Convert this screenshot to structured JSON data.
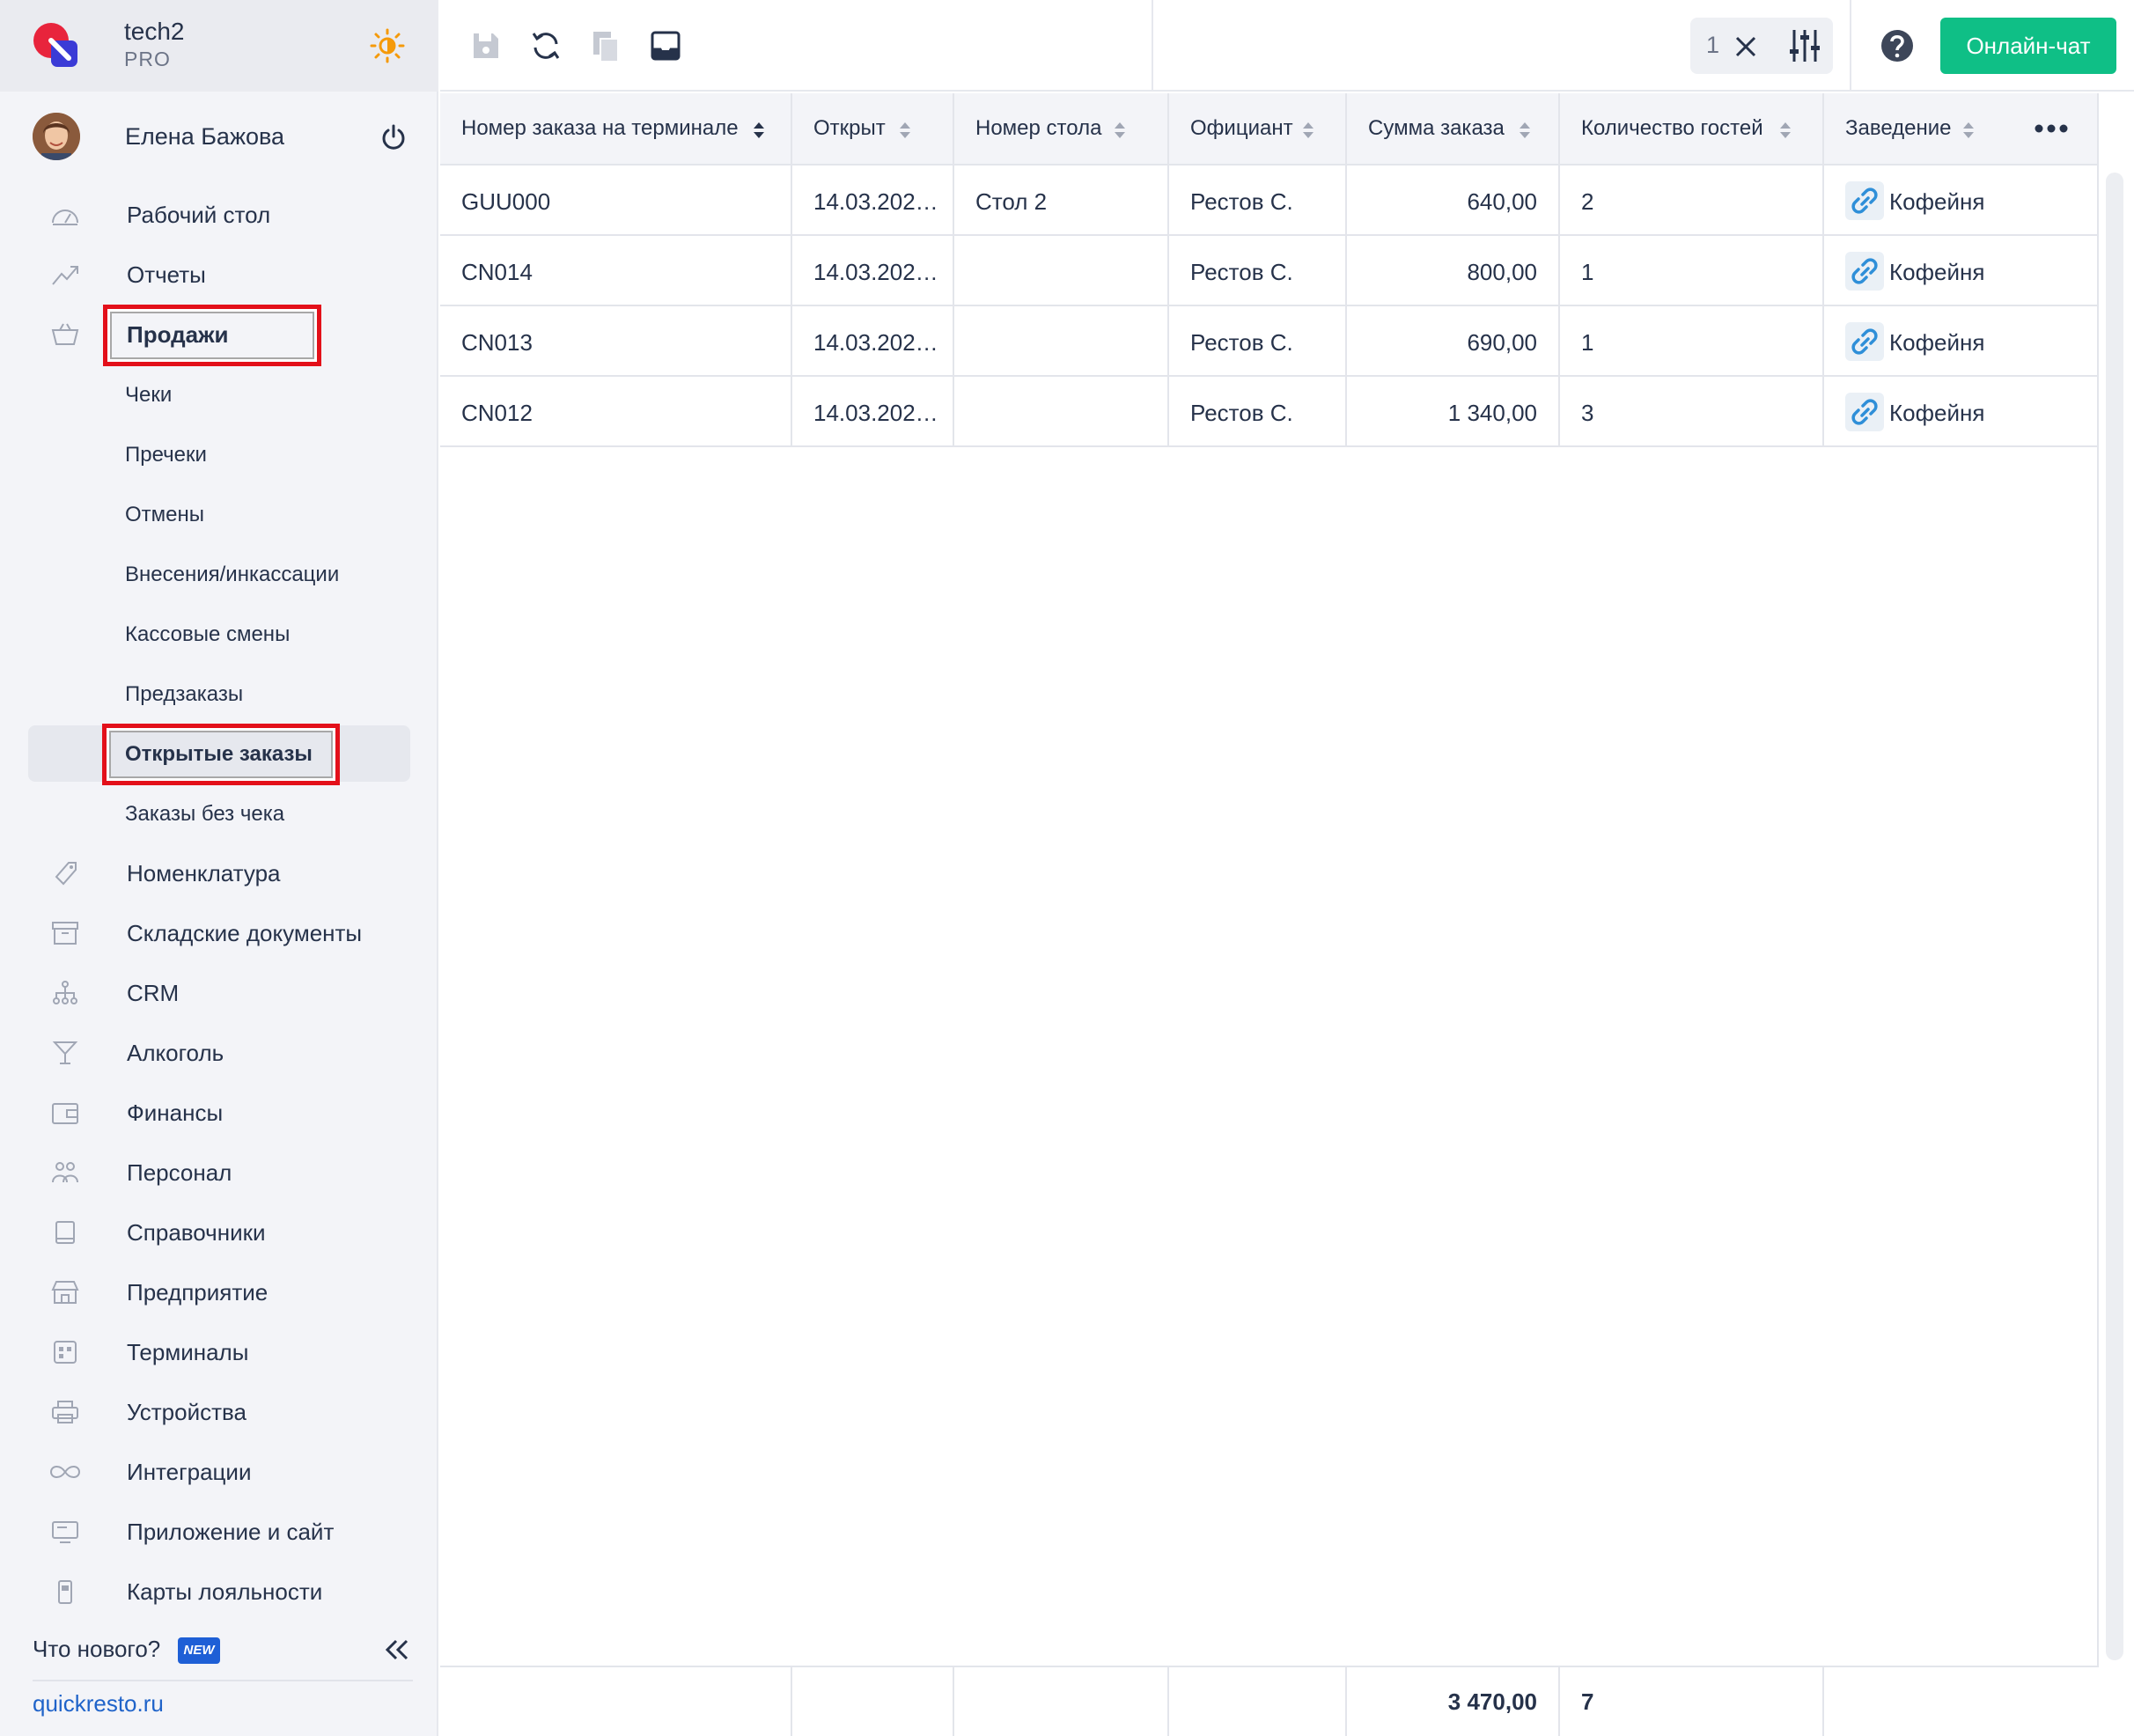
{
  "brand": {
    "name": "tech2",
    "plan": "PRO"
  },
  "user": {
    "name": "Елена Бажова"
  },
  "sidebar": {
    "items": [
      {
        "label": "Рабочий стол",
        "icon": "dashboard-icon"
      },
      {
        "label": "Отчеты",
        "icon": "chart-up-icon"
      },
      {
        "label": "Продажи",
        "icon": "basket-icon"
      },
      {
        "label": "Номенклатура",
        "icon": "tag-icon"
      },
      {
        "label": "Складские документы",
        "icon": "archive-icon"
      },
      {
        "label": "CRM",
        "icon": "hierarchy-icon"
      },
      {
        "label": "Алкоголь",
        "icon": "cocktail-icon"
      },
      {
        "label": "Финансы",
        "icon": "wallet-icon"
      },
      {
        "label": "Персонал",
        "icon": "people-icon"
      },
      {
        "label": "Справочники",
        "icon": "book-icon"
      },
      {
        "label": "Предприятие",
        "icon": "store-icon"
      },
      {
        "label": "Терминалы",
        "icon": "qr-icon"
      },
      {
        "label": "Устройства",
        "icon": "printer-icon"
      },
      {
        "label": "Интеграции",
        "icon": "infinity-icon"
      },
      {
        "label": "Приложение и сайт",
        "icon": "monitor-icon"
      },
      {
        "label": "Карты лояльности",
        "icon": "phone-icon"
      }
    ],
    "sales_subitems": [
      "Чеки",
      "Пречеки",
      "Отмены",
      "Внесения/инкассации",
      "Кассовые смены",
      "Предзаказы",
      "Открытые заказы",
      "Заказы без чека"
    ],
    "active_subitem": "Открытые заказы",
    "whats_new": "Что нового?",
    "new_badge": "NEW",
    "site": "quickresto.ru"
  },
  "toolbar": {
    "filter_count": "1",
    "chat_label": "Онлайн-чат"
  },
  "table": {
    "columns": [
      "Номер заказа на терминале",
      "Открыт",
      "Номер стола",
      "Официант",
      "Сумма заказа",
      "Количество гостей",
      "Заведение"
    ],
    "rows": [
      {
        "order": "GUU000",
        "opened": "14.03.202…",
        "table": "Стол 2",
        "waiter": "Рестов С.",
        "sum": "640,00",
        "guests": "2",
        "venue": "Кофейня"
      },
      {
        "order": "CN014",
        "opened": "14.03.202…",
        "table": "",
        "waiter": "Рестов С.",
        "sum": "800,00",
        "guests": "1",
        "venue": "Кофейня"
      },
      {
        "order": "CN013",
        "opened": "14.03.202…",
        "table": "",
        "waiter": "Рестов С.",
        "sum": "690,00",
        "guests": "1",
        "venue": "Кофейня"
      },
      {
        "order": "CN012",
        "opened": "14.03.202…",
        "table": "",
        "waiter": "Рестов С.",
        "sum": "1 340,00",
        "guests": "3",
        "venue": "Кофейня"
      }
    ],
    "totals": {
      "sum": "3 470,00",
      "guests": "7"
    }
  },
  "colors": {
    "accent": "#0fbf86",
    "highlight": "#e3101a",
    "link": "#1f63c9",
    "badge": "#1e5fd6"
  }
}
